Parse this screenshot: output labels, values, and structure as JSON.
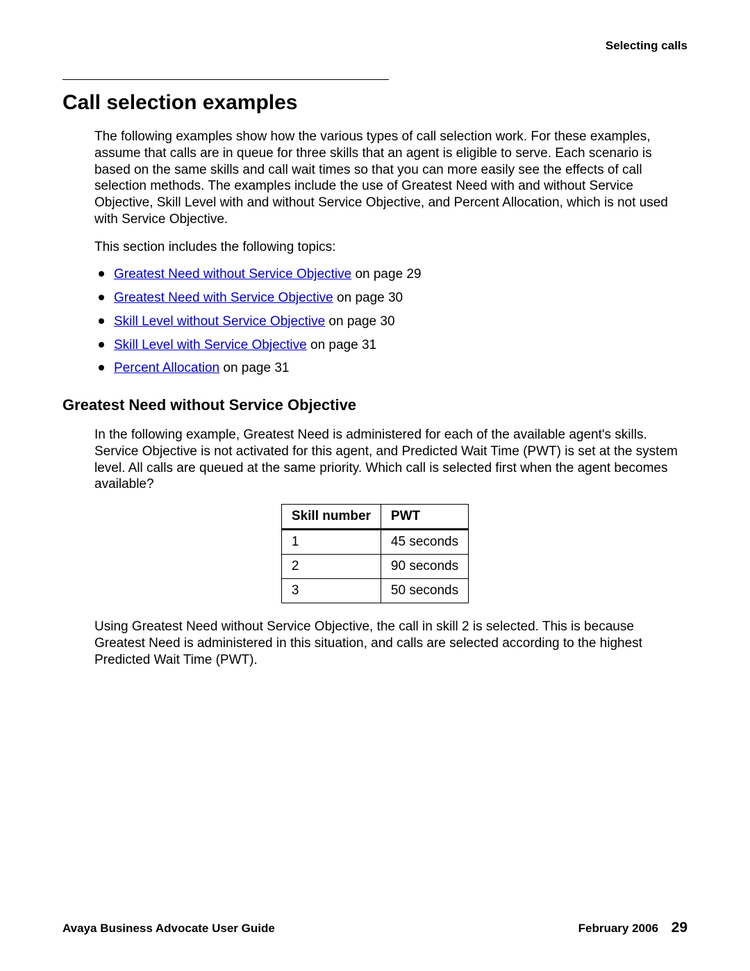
{
  "header": {
    "right": "Selecting calls"
  },
  "title": "Call selection examples",
  "intro": "The following examples show how the various types of call selection work. For these examples, assume that calls are in queue for three skills that an agent is eligible to serve. Each scenario is based on the same skills and call wait times so that you can more easily see the effects of call selection methods. The examples include the use of Greatest Need with and without Service Objective, Skill Level with and without Service Objective, and Percent Allocation, which is not used with Service Objective.",
  "topics_intro": "This section includes the following topics:",
  "topics": [
    {
      "link": "Greatest Need without Service Objective",
      "suffix": " on page 29"
    },
    {
      "link": "Greatest Need with Service Objective",
      "suffix": " on page 30"
    },
    {
      "link": "Skill Level without Service Objective",
      "suffix": " on page 30"
    },
    {
      "link": "Skill Level with Service Objective",
      "suffix": " on page 31"
    },
    {
      "link": "Percent Allocation",
      "suffix": " on page 31"
    }
  ],
  "subsection": {
    "title": "Greatest Need without Service Objective",
    "para1": "In the following example, Greatest Need is administered for each of the available agent's skills. Service Objective is not activated for this agent, and Predicted Wait Time (PWT) is set at the system level. All calls are queued at the same priority. Which call is selected first when the agent becomes available?",
    "table": {
      "headers": [
        "Skill number",
        "PWT"
      ],
      "rows": [
        [
          "1",
          "45 seconds"
        ],
        [
          "2",
          "90 seconds"
        ],
        [
          "3",
          "50 seconds"
        ]
      ]
    },
    "para2": "Using Greatest Need without Service Objective, the call in skill 2 is selected. This is because Greatest Need is administered in this situation, and calls are selected according to the highest Predicted Wait Time (PWT)."
  },
  "footer": {
    "left": "Avaya Business Advocate User Guide",
    "date": "February 2006",
    "page": "29"
  }
}
